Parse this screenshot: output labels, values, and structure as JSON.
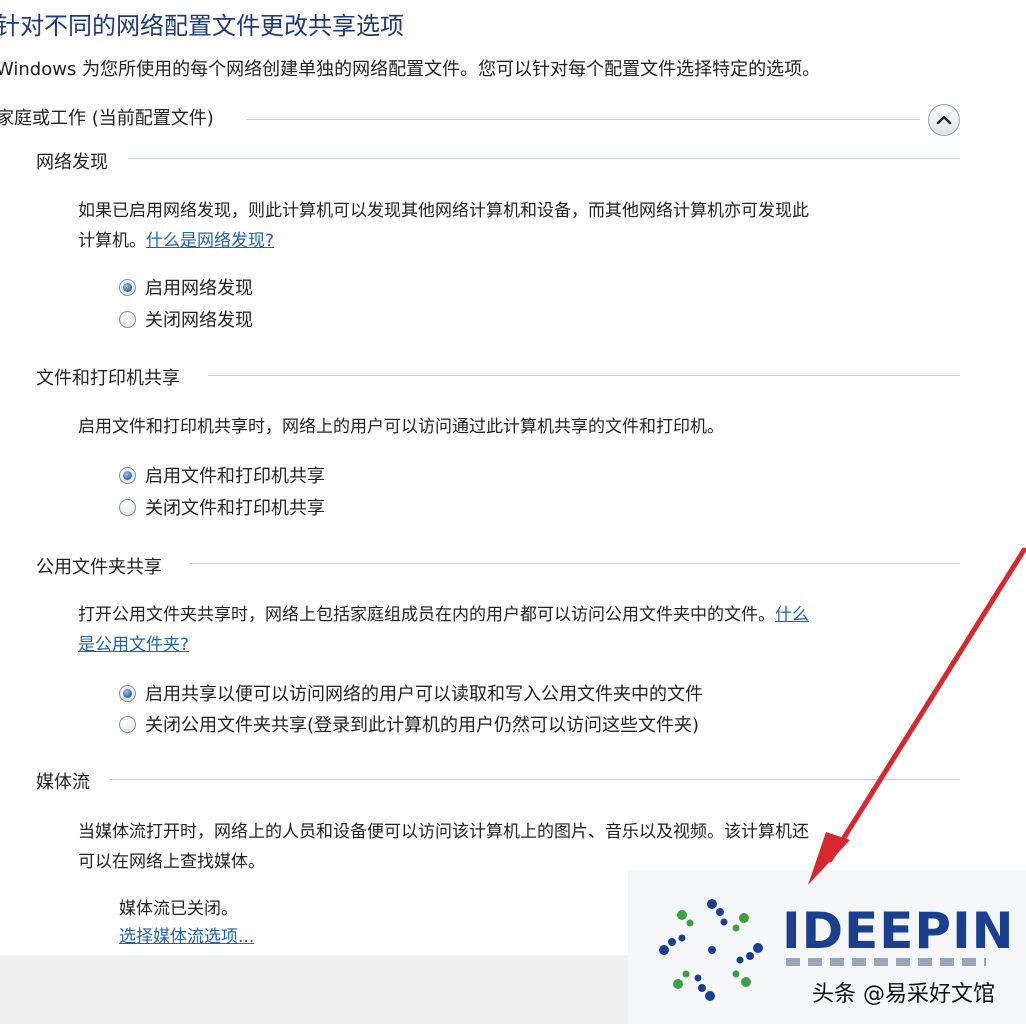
{
  "page": {
    "title": "针对不同的网络配置文件更改共享选项",
    "description": "Windows 为您所使用的每个网络创建单独的网络配置文件。您可以针对每个配置文件选择特定的选项。"
  },
  "profile": {
    "label": "家庭或工作 (当前配置文件)",
    "collapse_icon": "chevron-up-icon"
  },
  "sections": {
    "network_discovery": {
      "title": "网络发现",
      "text_line1": "如果已启用网络发现，则此计算机可以发现其他网络计算机和设备，而其他网络计算机亦可发现此",
      "text_line2": "计算机。",
      "link": "什么是网络发现?",
      "options": [
        "启用网络发现",
        "关闭网络发现"
      ],
      "selected": 0
    },
    "file_printer": {
      "title": "文件和打印机共享",
      "text": "启用文件和打印机共享时，网络上的用户可以访问通过此计算机共享的文件和打印机。",
      "options": [
        "启用文件和打印机共享",
        "关闭文件和打印机共享"
      ],
      "selected": 0
    },
    "public_folder": {
      "title": "公用文件夹共享",
      "text_line1": "打开公用文件夹共享时，网络上包括家庭组成员在内的用户都可以访问公用文件夹中的文件。",
      "link_part1": "什么",
      "link_part2": "是公用文件夹?",
      "options": [
        "启用共享以便可以访问网络的用户可以读取和写入公用文件夹中的文件",
        "关闭公用文件夹共享(登录到此计算机的用户仍然可以访问这些文件夹)"
      ],
      "selected": 0
    },
    "media_streaming": {
      "title": "媒体流",
      "text_line1": "当媒体流打开时，网络上的人员和设备便可以访问该计算机上的图片、音乐以及视频。该计算机还",
      "text_line2": "可以在网络上查找媒体。",
      "status": "媒体流已关闭。",
      "link": "选择媒体流选项..."
    }
  },
  "watermark": {
    "logo_text": "IDEEPIN",
    "caption": "头条 @易采好文馆"
  },
  "colors": {
    "title": "#1e3a7a",
    "link": "#1f63b5",
    "arrow": "#d8282f",
    "logo": "#1b3f8f"
  }
}
